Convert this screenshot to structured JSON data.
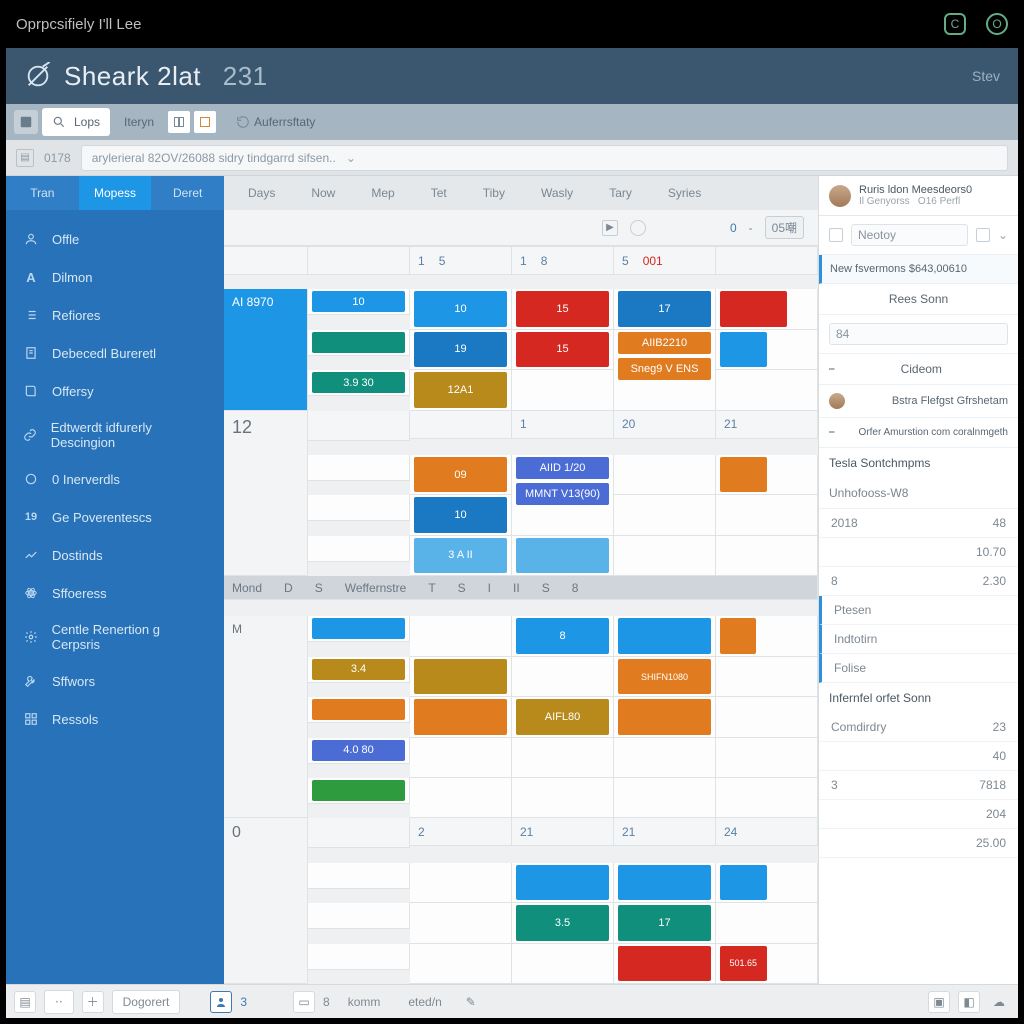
{
  "titlebar": {
    "caption": "Oprpcsifiely I'll Lee"
  },
  "header": {
    "title": "Sheark 2lat",
    "subtitle": "231",
    "user": "Stev"
  },
  "toolbar": {
    "search_label": "Lops",
    "btn_b": "Iteryn",
    "btn_c": "Auferrsftaty"
  },
  "subbar": {
    "tag": "0178",
    "crumb_a": "arylerieral 82OV/26088 sidry tindgarrd sifsen..",
    "crumb_caret": "⌄"
  },
  "sidebar": {
    "tabs": [
      "Tran",
      "Mopess",
      "Deret"
    ],
    "items": [
      {
        "icon": "person-icon",
        "label": "Offle"
      },
      {
        "icon": "letter-a-icon",
        "label": "Dilmon"
      },
      {
        "icon": "list-icon",
        "label": "Refiores"
      },
      {
        "icon": "doc-icon",
        "label": "Debecedl Bureretl"
      },
      {
        "icon": "book-icon",
        "label": "Offersy"
      },
      {
        "icon": "link-icon",
        "label": "Edtwerdt idfurerly Descingion"
      },
      {
        "icon": "circle-icon",
        "label": "0 Inerverdls"
      },
      {
        "icon": "gauge-icon",
        "label": "Ge Poverentescs"
      },
      {
        "icon": "chart-icon",
        "label": "Dostinds"
      },
      {
        "icon": "atom-icon",
        "label": "Sffoeress"
      },
      {
        "icon": "gear-icon",
        "label": "Centle Renertion g Cerpsris"
      },
      {
        "icon": "wrench-icon",
        "label": "Sffwors"
      },
      {
        "icon": "grid-icon",
        "label": "Ressols"
      }
    ]
  },
  "views": [
    "Days",
    "Now",
    "Mep",
    "Tet",
    "Tiby",
    "Wasly",
    "Tary",
    "Syries"
  ],
  "cal_toolbar": {
    "zero": "0",
    "dash": "-",
    "pill": "05嘲"
  },
  "grid": {
    "head": [
      {
        "a": "",
        "b": ""
      },
      {
        "a": "1",
        "b": "5"
      },
      {
        "a": "1",
        "b": "8"
      },
      {
        "a": "5",
        "b": "001"
      }
    ],
    "row1_label": "AI 8970",
    "row1": {
      "c1": "10",
      "c2": "10",
      "c3": "15",
      "c4": "17"
    },
    "row2": {
      "c2": "19",
      "c3": "15",
      "c4a": "AIIB2210",
      "c4b": "Sneg9 V ENS"
    },
    "row3": {
      "c1": "3.9 30",
      "c2": "12A1"
    },
    "row4_label": "12",
    "row4_head": {
      "c3": "1",
      "c4": "20",
      "c5": "21"
    },
    "row4": {
      "c2": "09",
      "c3a": "AIID 1/20",
      "c3b": "MMNT V13(90)"
    },
    "row5": {
      "c2a": "10",
      "c2b": "3 A II"
    },
    "week_labels": [
      "Mond",
      "D",
      "S",
      "Weffernstre",
      "T",
      "S",
      "I",
      "II",
      "S",
      "8"
    ],
    "row6_label": "M",
    "row6": {
      "c3": "8"
    },
    "row7": {
      "c1": "3.4",
      "c4": "SHIFN1080"
    },
    "row8": {
      "c3": "AIFL80"
    },
    "row9": {
      "c1": "4.0 80"
    },
    "row10_label": "0",
    "row10_head": {
      "c2": "2",
      "c3": "21",
      "c4": "21",
      "c5": "24"
    },
    "row10": {
      "c3": "3.5",
      "c4": "17"
    },
    "row11": {
      "c5": "501.65"
    }
  },
  "rpanel": {
    "user_name": "Ruris ldon Meesdeors0",
    "user_sub1": "Il Genyorss",
    "user_sub2": "O16 Perfl",
    "field_a": "Neotoy",
    "banner": "New fsvermons $643,00610",
    "btn": "Rees Sonn",
    "input_val": "84",
    "link_a": "Cideom",
    "link_b": "Bstra Flefgst Gfrshetam",
    "link_c": "Orfer Amurstion com coralnmgeth",
    "section_a": "Tesla Sontchmpms",
    "muted": "Unhofooss-W8",
    "rows": [
      {
        "l": "2018",
        "v": "48"
      },
      {
        "l": "",
        "v": "10.70"
      },
      {
        "l": "8",
        "v": "2.30"
      }
    ],
    "tags": [
      "Ptesen",
      "Indtotirn",
      "Folise"
    ],
    "section_b": "Infernfel orfet Sonn",
    "rows2": [
      {
        "l": "Comdirdry",
        "v": "23"
      },
      {
        "l": "",
        "v": "40"
      },
      {
        "l": "3",
        "v": "7818"
      },
      {
        "l": "",
        "v": "204"
      },
      {
        "l": "",
        "v": "25.00"
      }
    ]
  },
  "footer": {
    "btn_a": "Dogorert",
    "btn_b": "komm",
    "btn_c": "eted/n"
  }
}
